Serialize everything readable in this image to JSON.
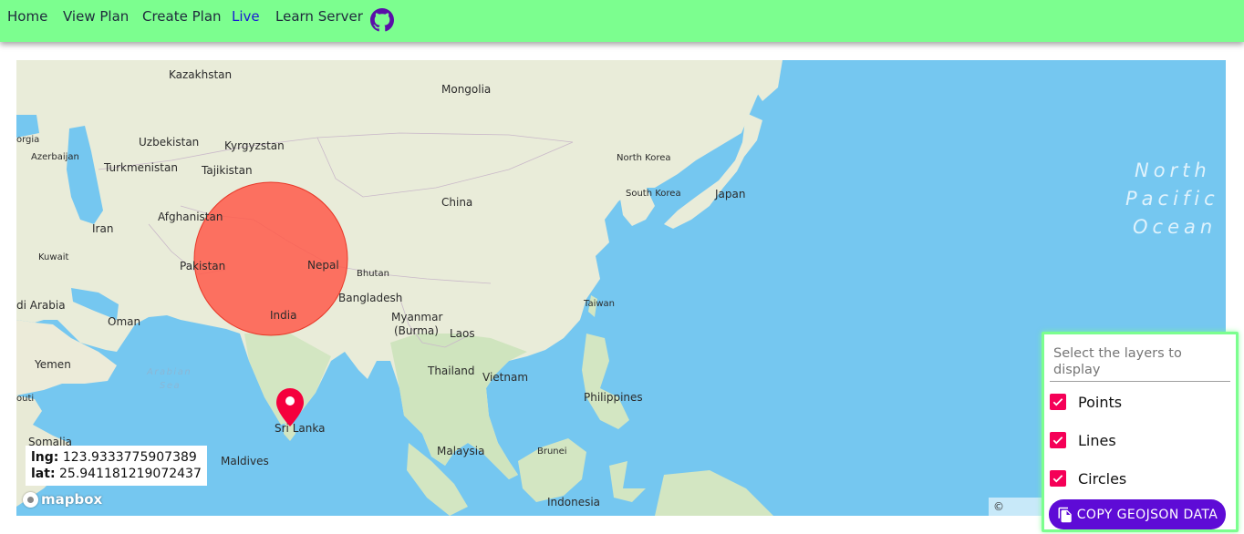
{
  "nav": {
    "items": [
      {
        "label": "Home"
      },
      {
        "label": "View Plan"
      },
      {
        "label": "Create Plan"
      },
      {
        "label": "Live"
      },
      {
        "label": "Learn Server"
      }
    ],
    "active": "Live",
    "github_icon": "github-icon"
  },
  "map": {
    "labels": {
      "kazakhstan": "Kazakhstan",
      "mongolia": "Mongolia",
      "uzbekistan": "Uzbekistan",
      "kyrgyzstan": "Kyrgyzstan",
      "georgia": "orgia",
      "azerbaijan": "Azerbaijan",
      "turkmenistan": "Turkmenistan",
      "tajikistan": "Tajikistan",
      "north_korea": "North Korea",
      "south_korea": "South Korea",
      "japan": "Japan",
      "china": "China",
      "afghanistan": "Afghanistan",
      "iran": "Iran",
      "kuwait": "Kuwait",
      "pakistan": "Pakistan",
      "nepal": "Nepal",
      "bhutan": "Bhutan",
      "bangladesh": "Bangladesh",
      "india": "India",
      "saudi": "di Arabia",
      "oman": "Oman",
      "myanmar_1": "Myanmar",
      "myanmar_2": "(Burma)",
      "laos": "Laos",
      "taiwan": "Taiwan",
      "yemen": "Yemen",
      "arabian_sea_1": "Arabian",
      "arabian_sea_2": "Sea",
      "thailand": "Thailand",
      "vietnam": "Vietnam",
      "philippines": "Philippines",
      "djibouti": "outi",
      "sri_lanka": "Sri Lanka",
      "somalia": "Somalia",
      "maldives": "Maldives",
      "malaysia": "Malaysia",
      "brunei": "Brunei",
      "indonesia": "Indonesia",
      "ocean_1": "North",
      "ocean_2": "Pacific",
      "ocean_3": "Ocean"
    },
    "coords": {
      "lng_label": "lng:",
      "lng_value": "123.9333775907389",
      "lat_label": "lat:",
      "lat_value": "25.941181219072437"
    },
    "logo_text": "mapbox",
    "attribution": "© Mapbox",
    "circle_color": "#ff5a4a",
    "marker_color": "#f5003d",
    "marker_icon": "map-pin-icon"
  },
  "layers_panel": {
    "title": "Select the layers to display",
    "layers": [
      {
        "label": "Points",
        "checked": true
      },
      {
        "label": "Lines",
        "checked": true
      },
      {
        "label": "Circles",
        "checked": true
      }
    ],
    "copy_button": "COPY GEOJSON DATA",
    "copy_icon": "copy-icon",
    "accent": "#f50057",
    "button_color": "#5e0bd6"
  }
}
